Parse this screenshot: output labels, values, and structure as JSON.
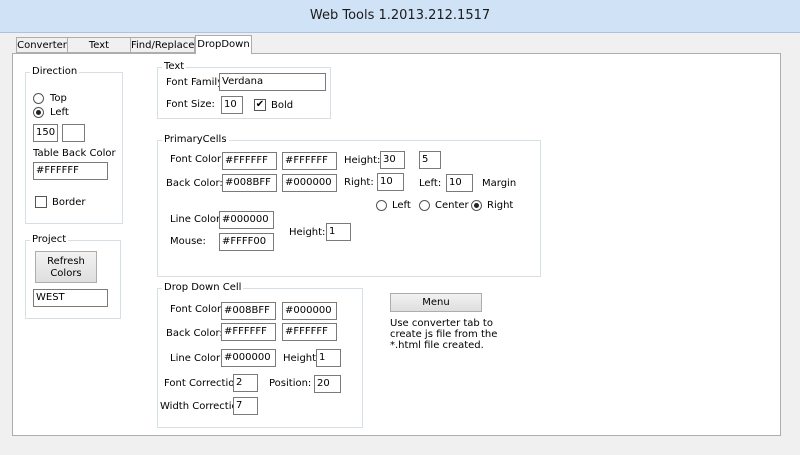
{
  "window": {
    "title": "Web Tools 1.2013.212.1517"
  },
  "tabs": [
    {
      "label": "Converter"
    },
    {
      "label": "Text Convert"
    },
    {
      "label": "Find/Replace"
    },
    {
      "label": "DropDown",
      "active": true
    }
  ],
  "direction": {
    "legend": "Direction",
    "options": [
      {
        "label": "Top",
        "selected": false
      },
      {
        "label": "Left",
        "selected": true
      }
    ],
    "value1": "150",
    "value2": "",
    "table_back_color_label": "Table Back Color",
    "table_back_color": "#FFFFFF",
    "border_label": "Border",
    "border_checked": false
  },
  "project": {
    "legend": "Project",
    "refresh_label_line1": "Refresh",
    "refresh_label_line2": "Colors",
    "name": "WEST"
  },
  "text": {
    "legend": "Text",
    "font_family_label": "Font Family:",
    "font_family": "Verdana",
    "font_size_label": "Font Size:",
    "font_size": "10",
    "bold_label": "Bold",
    "bold_checked": true
  },
  "primary_cells": {
    "legend": "PrimaryCells",
    "font_color_label": "Font Color:",
    "font_color_1": "#FFFFFF",
    "font_color_2": "#FFFFFF",
    "height_label": "Height:",
    "height": "30",
    "height_extra": "5",
    "back_color_label": "Back Color:",
    "back_color_1": "#008BFF",
    "back_color_2": "#000000",
    "right_label": "Right:",
    "right": "10",
    "left_label": "Left:",
    "left": "10",
    "margin_label": "Margin",
    "align_options": [
      {
        "label": "Left",
        "selected": false
      },
      {
        "label": "Center",
        "selected": false
      },
      {
        "label": "Right",
        "selected": true
      }
    ],
    "line_color_label": "Line Color:",
    "line_color": "#000000",
    "mouse_label": "Mouse:",
    "mouse": "#FFFF00",
    "line_height_label": "Height:",
    "line_height": "1"
  },
  "drop_down_cell": {
    "legend": "Drop Down Cell",
    "font_color_label": "Font Color:",
    "font_color_1": "#008BFF",
    "font_color_2": "#000000",
    "back_color_label": "Back Color:",
    "back_color_1": "#FFFFFF",
    "back_color_2": "#FFFFFF",
    "line_color_label": "Line Color:",
    "line_color": "#000000",
    "height_label": "Height:",
    "height": "1",
    "font_correction_label": "Font Correction:",
    "font_correction": "2",
    "position_label": "Position:",
    "position": "20",
    "width_correction_label": "Width Correction:",
    "width_correction": "7"
  },
  "menu": {
    "button_label": "Menu",
    "hint_line1": "Use converter tab to",
    "hint_line2": "create js file from the",
    "hint_line3": "*.html file created."
  }
}
